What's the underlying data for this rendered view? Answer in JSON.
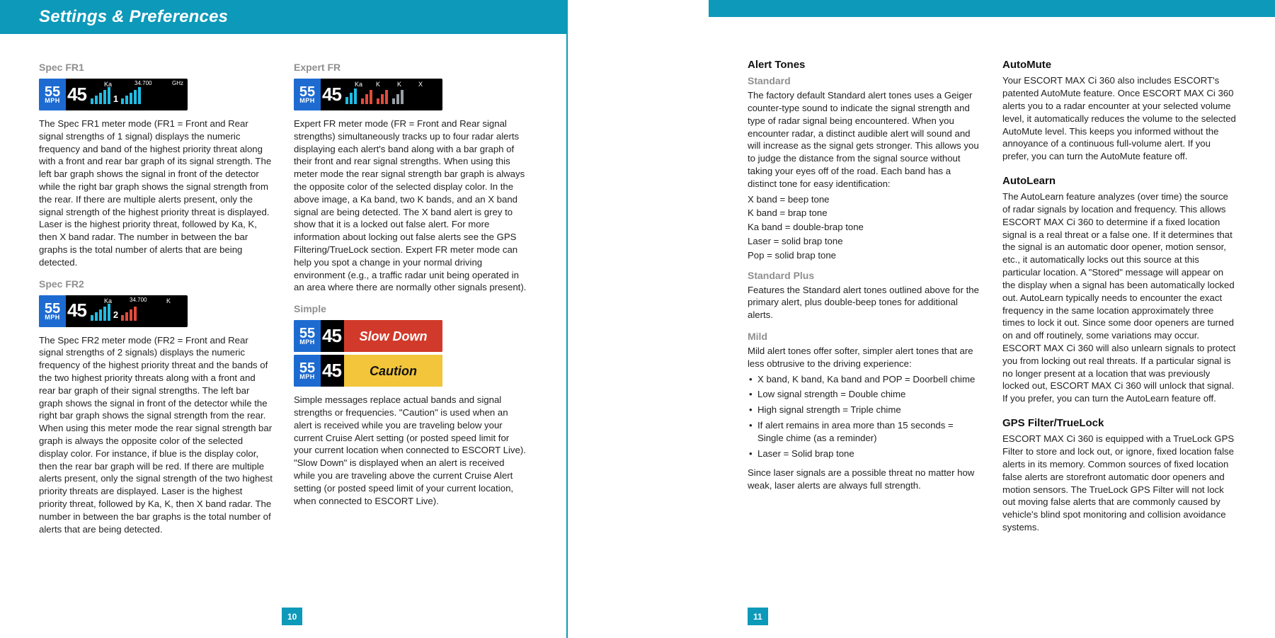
{
  "header": {
    "title": "Settings & Preferences"
  },
  "pageLeft": {
    "number": "10"
  },
  "pageRight": {
    "number": "11"
  },
  "display": {
    "speed": "55",
    "speedUnit": "MPH",
    "reading": "45",
    "ka": "Ka",
    "k": "K",
    "x": "X",
    "freq1": "34.700",
    "ghz": "GHz",
    "msgSlow": "Slow Down",
    "msgCaution": "Caution",
    "n1": "1",
    "n2": "2"
  },
  "leftPage": {
    "specFR1": {
      "title": "Spec FR1",
      "body": "The Spec FR1 meter mode (FR1 = Front and Rear signal strengths of 1 signal) displays the numeric frequency and band of the highest priority threat along with a front and rear bar graph of its signal strength. The left bar graph shows the signal in front of the detector while the right bar graph shows the signal strength from the rear. If there are multiple alerts present, only the signal strength of the highest priority threat is displayed. Laser is the highest priority threat, followed by Ka, K, then X band radar. The number in between the bar graphs is the total number of alerts that are being detected."
    },
    "specFR2": {
      "title": "Spec FR2",
      "body": "The Spec FR2 meter mode (FR2 = Front and Rear signal strengths of 2 signals) displays the numeric frequency of the highest priority threat and the bands of the two highest priority threats along with a front and rear bar graph of their signal strengths. The left bar graph shows the signal in front of the detector while the right bar graph shows the signal strength from the rear. When using this meter mode the rear signal strength bar graph is always the opposite color of the selected display color. For instance, if blue is the display color, then the rear bar graph will be red. If there are multiple alerts present, only the signal strength of the two highest priority threats are displayed. Laser is the highest priority threat, followed by Ka, K, then X band radar. The number in between the bar graphs is the total number of alerts that are being detected."
    },
    "expertFR": {
      "title": "Expert FR",
      "body": "Expert FR meter mode (FR = Front and Rear signal strengths) simultaneously tracks up to four radar alerts displaying each alert's band along with a bar graph of their front and rear signal strengths. When using this meter mode the rear signal strength bar graph is always the opposite color of the selected display color. In the above image, a Ka band, two K bands, and an X band signal are being detected. The X band alert is grey to show that it is a locked out false alert. For more information about locking out false alerts see the GPS Filtering/TrueLock section. Expert FR meter mode can help you spot a change in your normal driving environment (e.g., a traffic radar unit being operated in an area where there are normally other signals present)."
    },
    "simple": {
      "title": "Simple",
      "body": "Simple messages replace actual bands and signal strengths or frequencies. \"Caution\" is used when an alert is received while you are traveling below your current Cruise Alert setting (or posted speed limit for your current location when connected to ESCORT Live). \"Slow Down\" is displayed when an alert is received while you are traveling above the current Cruise Alert setting (or posted speed limit of your current location, when connected to ESCORT Live)."
    }
  },
  "rightPage": {
    "alertTones": {
      "title": "Alert Tones",
      "standardTitle": "Standard",
      "standardBody": "The factory default Standard alert tones uses a Geiger counter-type sound to indicate the signal strength and type of radar signal being encountered. When you encounter radar, a distinct audible alert will sound and will increase as the signal gets stronger. This allows you to judge the distance from the signal source without taking your eyes off of the road. Each band has a distinct tone for easy identification:",
      "bandX": "X band = beep tone",
      "bandK": "K band = brap tone",
      "bandKa": "Ka band = double-brap tone",
      "bandLaser": "Laser = solid brap tone",
      "bandPop": "Pop = solid brap tone",
      "stdPlusTitle": "Standard Plus",
      "stdPlusBody": "Features the Standard alert tones outlined above for the primary alert, plus double-beep tones for additional alerts.",
      "mildTitle": "Mild",
      "mildIntro": "Mild alert tones offer softer, simpler alert tones that are less obtrusive to the driving experience:",
      "mild1": "X band, K band, Ka band and POP = Doorbell chime",
      "mild2": "Low signal strength = Double chime",
      "mild3": "High signal strength = Triple chime",
      "mild4": "If alert remains in area more than 15 seconds = Single chime (as a reminder)",
      "mild5": "Laser = Solid brap tone",
      "laserNote": "Since laser signals are a possible threat no matter how weak, laser alerts are always full strength."
    },
    "autoMute": {
      "title": "AutoMute",
      "body": "Your ESCORT MAX Ci 360 also includes ESCORT's patented AutoMute feature. Once ESCORT MAX Ci 360 alerts you to a radar encounter at your selected volume level, it automatically reduces the volume to the selected AutoMute level. This keeps you informed without the annoyance of a continuous full-volume alert. If you prefer, you can turn the AutoMute feature off."
    },
    "autoLearn": {
      "title": "AutoLearn",
      "body": "The AutoLearn feature analyzes (over time) the source of radar signals by location and frequency. This allows ESCORT MAX Ci 360 to determine if a fixed location signal is a real threat or a false one. If it determines that the signal is an automatic door opener, motion sensor, etc., it automatically locks out this source at this particular location. A \"Stored\" message will appear on the display when a signal has been automatically locked out. AutoLearn typically needs to encounter the exact frequency in the same location approximately three times to lock it out. Since some door openers are turned on and off routinely, some variations may occur. ESCORT MAX Ci 360 will also unlearn signals to protect you from locking out real threats. If a particular signal is no longer present at a location that was previously locked out, ESCORT MAX Ci 360 will unlock that signal. If you prefer, you can turn the AutoLearn feature off."
    },
    "gpsFilter": {
      "title": "GPS Filter/TrueLock",
      "body": "ESCORT MAX Ci 360 is equipped with a TrueLock GPS Filter to store and lock out, or ignore, fixed location false alerts in its memory. Common sources of fixed location false alerts are storefront automatic door openers and motion sensors. The TrueLock GPS Filter will not lock out moving false alerts that are commonly caused by vehicle's blind spot monitoring and collision avoidance systems."
    }
  }
}
